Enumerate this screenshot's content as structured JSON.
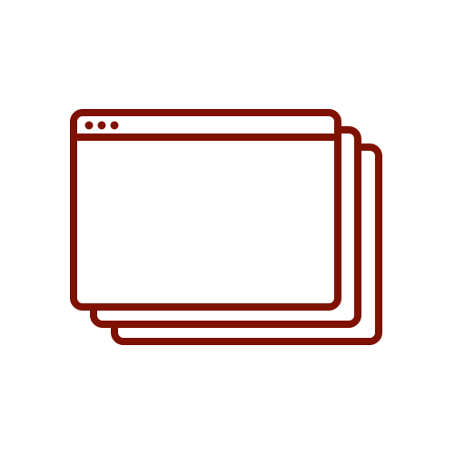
{
  "icon": {
    "name": "stacked-windows-icon",
    "stroke_color": "#7f1100",
    "fill_color": "#ffffff",
    "window_count": 3,
    "title_bar_dot_count": 3
  }
}
